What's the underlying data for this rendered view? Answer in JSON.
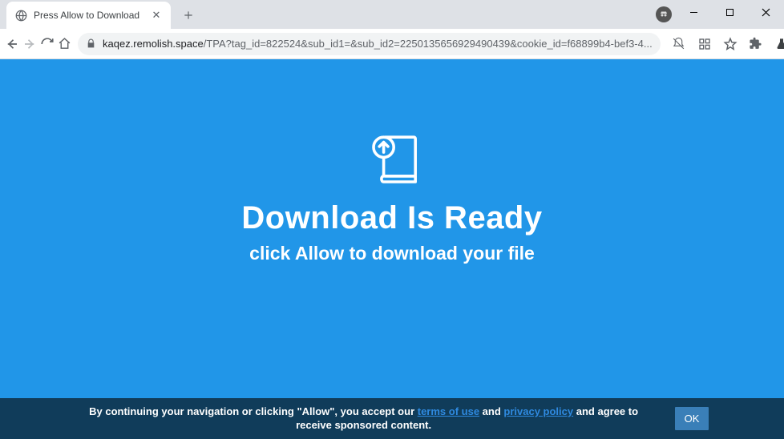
{
  "window": {
    "minimize": "—",
    "maximize": "□",
    "close": "✕"
  },
  "tab": {
    "title": "Press Allow to Download",
    "close": "✕",
    "new": "+"
  },
  "toolbar": {
    "url_host": "kaqez.remolish.space",
    "url_path": "/TPA?tag_id=822524&sub_id1=&sub_id2=2250135656929490439&cookie_id=f68899b4-bef3-4..."
  },
  "page": {
    "headline": "Download Is Ready",
    "subhead": "click Allow to download your file"
  },
  "consent": {
    "part1": "By continuing your navigation or clicking \"Allow\", you accept our ",
    "terms": "terms of use",
    "and": " and ",
    "privacy": "privacy policy",
    "part2": " and agree to receive sponsored content.",
    "ok": "OK"
  }
}
